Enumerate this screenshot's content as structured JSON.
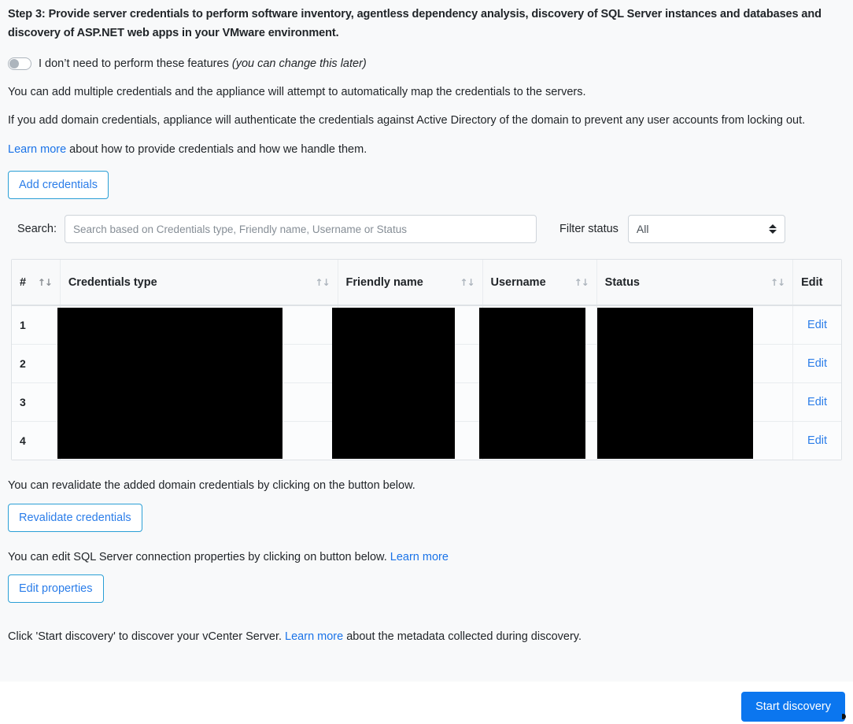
{
  "heading": "Step 3: Provide server credentials to perform software inventory, agentless dependency analysis, discovery of SQL Server instances and databases and discovery of ASP.NET web apps in your VMware environment.",
  "toggle": {
    "label": "I don’t need to perform these features",
    "note": "(you can change this later)",
    "state": "off"
  },
  "paragraphs": {
    "multi_credentials": "You can add multiple credentials and the appliance will attempt to automatically map the credentials to the servers.",
    "domain_credentials": "If you add domain credentials, appliance will authenticate the credentials against Active Directory of the domain to prevent any user accounts from locking out.",
    "learn_more_link": "Learn more",
    "learn_more_tail": " about how to provide credentials and how we handle them.",
    "revalidate_text": "You can revalidate the added domain credentials by clicking on the button below.",
    "edit_properties_text": "You can edit SQL Server connection properties by clicking on button below. ",
    "edit_properties_link": "Learn more",
    "start_discovery_lead": "Click 'Start discovery' to discover your vCenter Server. ",
    "start_discovery_link": "Learn more",
    "start_discovery_tail": " about the metadata collected during discovery."
  },
  "buttons": {
    "add_credentials": "Add credentials",
    "revalidate_credentials": "Revalidate credentials",
    "edit_properties": "Edit properties",
    "start_discovery": "Start discovery"
  },
  "search": {
    "label": "Search:",
    "value": "",
    "placeholder": "Search based on Credentials type, Friendly name, Username or Status"
  },
  "filter": {
    "label": "Filter status",
    "selected": "All",
    "options": [
      "All"
    ]
  },
  "table": {
    "columns": [
      {
        "label": "#",
        "sortable": true
      },
      {
        "label": "Credentials type",
        "sortable": true
      },
      {
        "label": "Friendly name",
        "sortable": true
      },
      {
        "label": "Username",
        "sortable": true
      },
      {
        "label": "Status",
        "sortable": true
      },
      {
        "label": "Edit",
        "sortable": false
      }
    ],
    "sort_icon": "↑↓",
    "rows": [
      {
        "index": "1",
        "credentials_type": "",
        "friendly_name": "",
        "username": "",
        "status": "",
        "edit": "Edit"
      },
      {
        "index": "2",
        "credentials_type": "",
        "friendly_name": "",
        "username": "",
        "status": "",
        "edit": "Edit"
      },
      {
        "index": "3",
        "credentials_type": "",
        "friendly_name": "",
        "username": "",
        "status": "",
        "edit": "Edit"
      },
      {
        "index": "4",
        "credentials_type": "",
        "friendly_name": "",
        "username": "",
        "status": "",
        "edit": "Edit"
      }
    ],
    "redaction_color": "#000000"
  },
  "colors": {
    "accent": "#0b76ef",
    "link": "#2b7de9",
    "outline_border": "#2a9fd6",
    "page_bg": "#f8f9fa"
  }
}
